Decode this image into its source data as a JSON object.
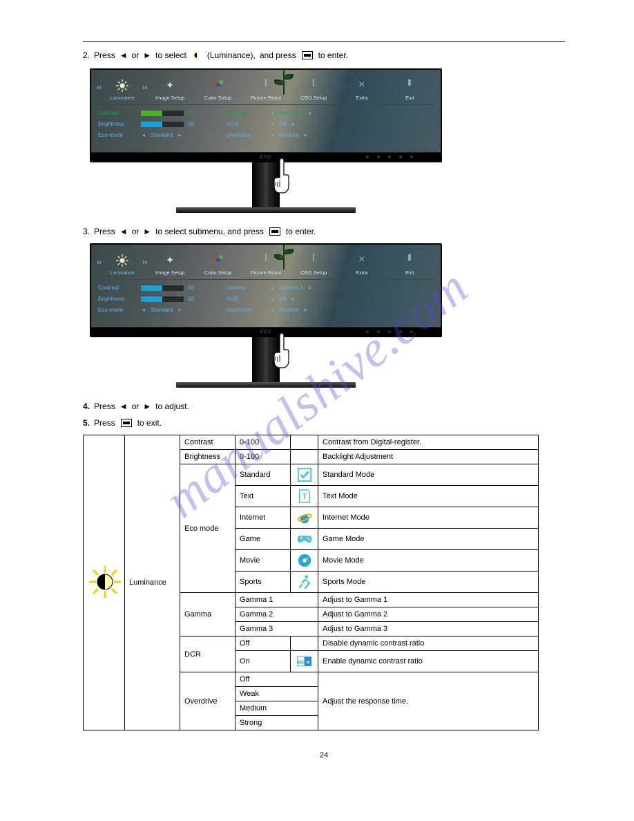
{
  "step2": {
    "num": "2.",
    "text_a": "Press",
    "text_b": "or",
    "text_c": "to select",
    "target": "(Luminance),",
    "text_d": "and press",
    "text_e": "to enter."
  },
  "step3": {
    "num": "3.",
    "text_a": "Press",
    "text_b": "or",
    "text_c": "to select submenu, and press",
    "text_d": "to enter."
  },
  "osd": {
    "tabs": [
      "Luminance",
      "Image Setup",
      "Color Setup",
      "Picture Boost",
      "OSD Setup",
      "Extra",
      "Exit"
    ],
    "rows_left": [
      {
        "label": "Contrast",
        "value": "50",
        "fill": 50,
        "green": true
      },
      {
        "label": "Brightness",
        "value": "50",
        "fill": 50,
        "green": false
      },
      {
        "label": "Eco mode",
        "select": "Standard"
      }
    ],
    "rows_right": [
      {
        "label": "Gamma",
        "select": "Gamma 1"
      },
      {
        "label": "DCR",
        "select": "Off"
      },
      {
        "label": "OverDrive",
        "select": "Medium"
      }
    ],
    "brand": "AOC"
  },
  "osd2": {
    "rows_left": [
      {
        "label": "Contrast",
        "value": "50",
        "fill": 50
      },
      {
        "label": "Brightness",
        "value": "50",
        "fill": 50
      },
      {
        "label": "Eco mode",
        "select": "Standard"
      }
    ]
  },
  "table": {
    "group": "Luminance",
    "rows": [
      {
        "name": "Contrast",
        "range": "0-100",
        "icon": "",
        "desc": "Contrast from Digital-register."
      },
      {
        "name": "Brightness",
        "range": "0-100",
        "icon": "",
        "desc": "Backlight Adjustment"
      },
      {
        "name": "",
        "range": "Standard",
        "icon": "check",
        "desc": "Standard Mode"
      },
      {
        "name": "",
        "range": "Text",
        "icon": "text",
        "desc": "Text Mode"
      },
      {
        "name": "",
        "range": "Internet",
        "icon": "ie",
        "desc": "Internet Mode"
      },
      {
        "name": "Eco mode",
        "range": "Game",
        "icon": "game",
        "desc": "Game Mode"
      },
      {
        "name": "",
        "range": "Movie",
        "icon": "disc",
        "desc": "Movie Mode"
      },
      {
        "name": "",
        "range": "Sports",
        "icon": "run",
        "desc": "Sports Mode"
      },
      {
        "name": "Gamma",
        "range": "Gamma 1",
        "icon": "",
        "desc": "Adjust to Gamma 1"
      },
      {
        "name": "",
        "range": "Gamma 2",
        "icon": "",
        "desc": "Adjust to Gamma 2"
      },
      {
        "name": "",
        "range": "Gamma 3",
        "icon": "",
        "desc": "Adjust to Gamma 3"
      },
      {
        "name": "DCR",
        "range": "Off",
        "icon": "",
        "desc": "Disable dynamic contrast ratio"
      },
      {
        "name": "",
        "range": "On",
        "icon": "dcr",
        "desc": "Enable dynamic contrast ratio"
      },
      {
        "name": "Overdrive",
        "range": "Off",
        "icon": "",
        "desc": ""
      },
      {
        "name": "",
        "range": "Weak",
        "icon": "",
        "desc": "Adjust the response time."
      },
      {
        "name": "",
        "range": "Medium",
        "icon": "",
        "desc": ""
      },
      {
        "name": "",
        "range": "Strong",
        "icon": "",
        "desc": ""
      }
    ]
  },
  "watermark": "manualshive.com",
  "page": "24"
}
